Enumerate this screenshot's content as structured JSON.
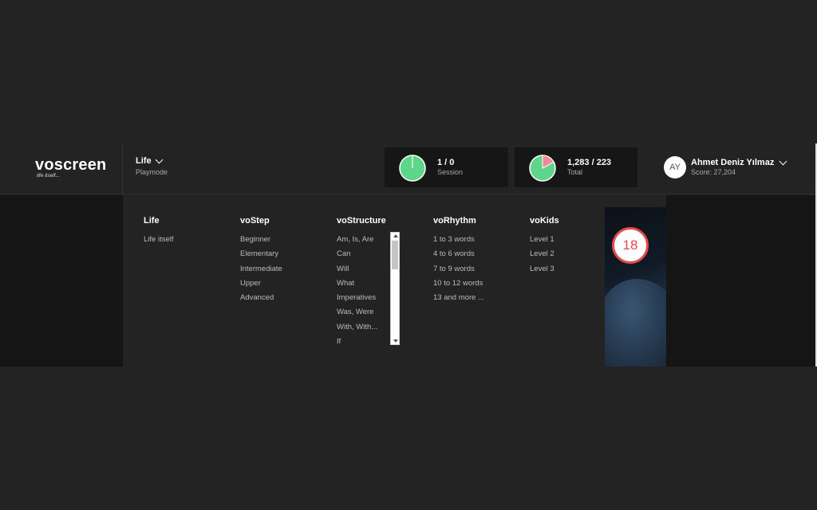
{
  "brand": {
    "name": "voscreen",
    "tagline": "life itself..."
  },
  "mode": {
    "title": "Life",
    "subtitle": "Playmode"
  },
  "stats": {
    "session": {
      "value": "1 / 0",
      "label": "Session",
      "fraction": 0.0,
      "color": "#5ed68a"
    },
    "total": {
      "value": "1,283 / 223",
      "label": "Total",
      "fraction": 0.17,
      "color": "#5ed68a",
      "accent": "#f08a9a"
    }
  },
  "user": {
    "initials": "AY",
    "name": "Ahmet Deniz Yılmaz",
    "score": "Score: 27,204"
  },
  "menu": {
    "columns": [
      {
        "heading": "Life",
        "items": [
          "Life itself"
        ]
      },
      {
        "heading": "voStep",
        "items": [
          "Beginner",
          "Elementary",
          "Intermediate",
          "Upper",
          "Advanced"
        ]
      },
      {
        "heading": "voStructure",
        "items": [
          "Am, Is, Are",
          "Can",
          "Will",
          "What",
          "Imperatives",
          "Was, Were",
          "With, With...",
          "If"
        ]
      },
      {
        "heading": "voRhythm",
        "items": [
          "1 to 3 words",
          "4 to 6 words",
          "7 to 9 words",
          "10 to 12 words",
          "13 and more ..."
        ]
      },
      {
        "heading": "voKids",
        "items": [
          "Level 1",
          "Level 2",
          "Level 3"
        ]
      }
    ]
  },
  "rating_badge": "18"
}
